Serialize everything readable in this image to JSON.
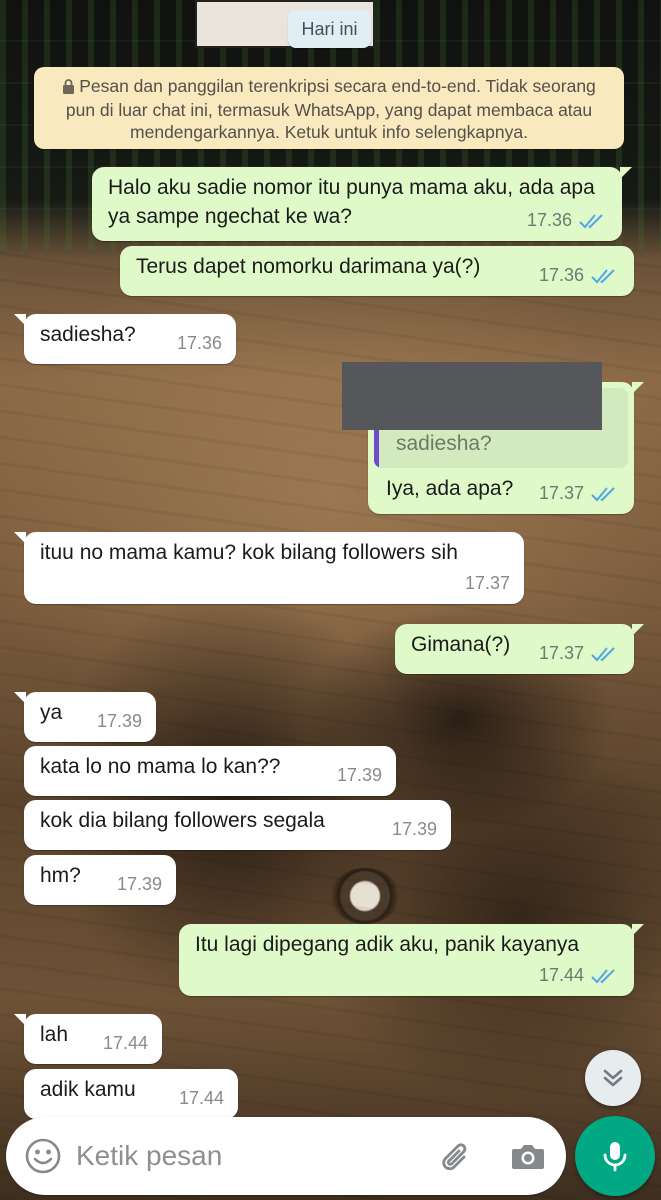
{
  "chat": {
    "date_label": "Hari ini",
    "encryption_notice": "Pesan dan panggilan terenkripsi secara end-to-end. Tidak seorang pun di luar chat ini, termasuk WhatsApp, yang dapat membaca atau mendengarkannya. Ketuk untuk info selengkapnya.",
    "messages": [
      {
        "direction": "out",
        "text": "Halo aku sadie nomor itu punya mama aku, ada apa ya sampe ngechat ke wa?",
        "time": "17.36",
        "status": "read"
      },
      {
        "direction": "out",
        "text": "Terus dapet nomorku darimana ya(?)",
        "time": "17.36",
        "status": "read"
      },
      {
        "direction": "in",
        "text": "sadiesha?",
        "time": "17.36"
      },
      {
        "direction": "out",
        "quoted_text": "sadiesha?",
        "text": "Iya, ada apa?",
        "time": "17.37",
        "status": "read"
      },
      {
        "direction": "in",
        "text": "ituu no mama kamu? kok bilang followers sih",
        "time": "17.37"
      },
      {
        "direction": "out",
        "text": "Gimana(?)",
        "time": "17.37",
        "status": "read"
      },
      {
        "direction": "in",
        "text": "ya",
        "time": "17.39"
      },
      {
        "direction": "in",
        "text": "kata lo no mama lo kan??",
        "time": "17.39"
      },
      {
        "direction": "in",
        "text": "kok dia bilang followers segala",
        "time": "17.39"
      },
      {
        "direction": "in",
        "text": "hm?",
        "time": "17.39"
      },
      {
        "direction": "out",
        "text": "Itu lagi dipegang adik aku, panik kayanya",
        "time": "17.44",
        "status": "read"
      },
      {
        "direction": "in",
        "text": "lah",
        "time": "17.44"
      },
      {
        "direction": "in",
        "text": "adik kamu",
        "time": "17.44"
      }
    ]
  },
  "composer": {
    "placeholder": "Ketik pesan",
    "value": ""
  },
  "icons": {
    "scroll": "double-chevron-down-icon",
    "emoji": "emoji-icon",
    "attach": "paperclip-icon",
    "camera": "camera-icon",
    "mic": "microphone-icon",
    "lock": "lock-icon",
    "read": "double-check-icon"
  },
  "colors": {
    "outgoing_bubble": "#dff9c9",
    "incoming_bubble": "#ffffff",
    "read_ticks": "#4fa7e8",
    "mic_button": "#00a884",
    "notice_bg": "#f8e9be"
  }
}
